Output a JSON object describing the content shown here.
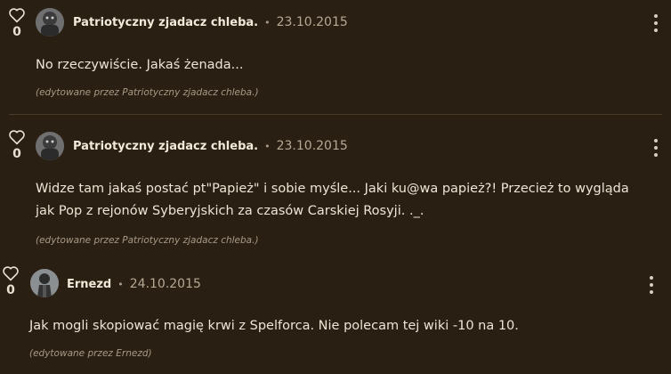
{
  "comments": [
    {
      "author": "Patriotyczny zjadacz chleba.",
      "date": "23.10.2015",
      "votes": "0",
      "text": "No rzeczywiście. Jakaś żenada...",
      "edited": "(edytowane przez Patriotyczny zjadacz chleba.)"
    },
    {
      "author": "Patriotyczny zjadacz chleba.",
      "date": "23.10.2015",
      "votes": "0",
      "text": "Widze tam jakaś postać pt\"Papież\" i sobie myśle... Jaki ku@wa papież?! Przecież to wygląda jak Pop z rejonów Syberyjskich za czasów Carskiej Rosyji. ._.",
      "edited": "(edytowane przez Patriotyczny zjadacz chleba.)"
    },
    {
      "author": "Ernezd",
      "date": "24.10.2015",
      "votes": "0",
      "text": "Jak mogli skopiować magię krwi z Spelforca. Nie polecam tej wiki -10 na 10.",
      "edited": "(edytowane przez Ernezd)"
    }
  ],
  "separator": "•",
  "icons": {
    "like": "heart-outline-icon",
    "more": "more-vertical-icon"
  },
  "colors": {
    "background": "#2a1f13",
    "text": "#eee5d6",
    "muted": "#a89a86"
  }
}
